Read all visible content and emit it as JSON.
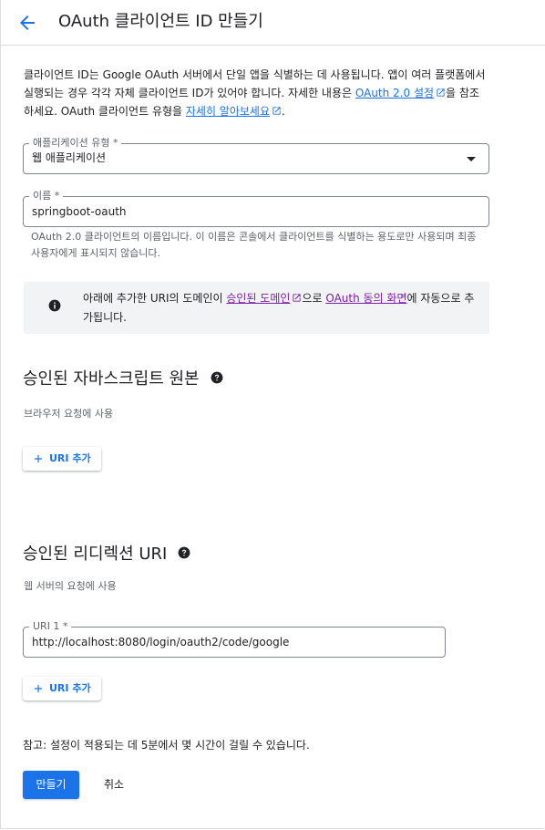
{
  "header": {
    "title": "OAuth 클라이언트 ID 만들기",
    "back_icon": "arrow-left-icon"
  },
  "intro": {
    "text_1": "클라이언트 ID는 Google OAuth 서버에서 단일 앱을 식별하는 데 사용됩니다. 앱이 여러 플랫폼에서 실행되는 경우 각각 자체 클라이언트 ID가 있어야 합니다. 자세한 내용은 ",
    "link_oauth": "OAuth 2.0 설정",
    "text_2": "을 참조하세요. OAuth 클라이언트 유형을 ",
    "link_learn": "자세히 알아보세요",
    "text_3": "."
  },
  "app_type": {
    "label": "애플리케이션 유형 *",
    "value": "웹 애플리케이션"
  },
  "name_field": {
    "label": "이름 *",
    "value": "springboot-oauth",
    "hint": "OAuth 2.0 클라이언트의 이름입니다. 이 이름은 콘솔에서 클라이언트를 식별하는 용도로만 사용되며 최종 사용자에게 표시되지 않습니다."
  },
  "info_box": {
    "text_1": "아래에 추가한 URI의 도메인이 ",
    "link_domains": "승인된 도메인",
    "text_2": "으로 ",
    "link_consent": "OAuth 동의 화면",
    "text_3": "에 자동으로 추가됩니다."
  },
  "js_origins": {
    "heading": "승인된 자바스크립트 원본",
    "subtitle": "브라우저 요청에 사용",
    "add_button": "URI 추가"
  },
  "redirect_uris": {
    "heading": "승인된 리디렉션 URI",
    "subtitle": "웹 서버의 요청에 사용",
    "uri_label": "URI 1 *",
    "uri_value": "http://localhost:8080/login/oauth2/code/google",
    "add_button": "URI 추가"
  },
  "note": "참고: 설정이 적용되는 데 5분에서 몇 시간이 걸릴 수 있습니다.",
  "actions": {
    "create": "만들기",
    "cancel": "취소"
  },
  "colors": {
    "primary": "#1a73e8",
    "visited_link": "#7b1fa2",
    "info_bg": "#f1f3f4"
  }
}
